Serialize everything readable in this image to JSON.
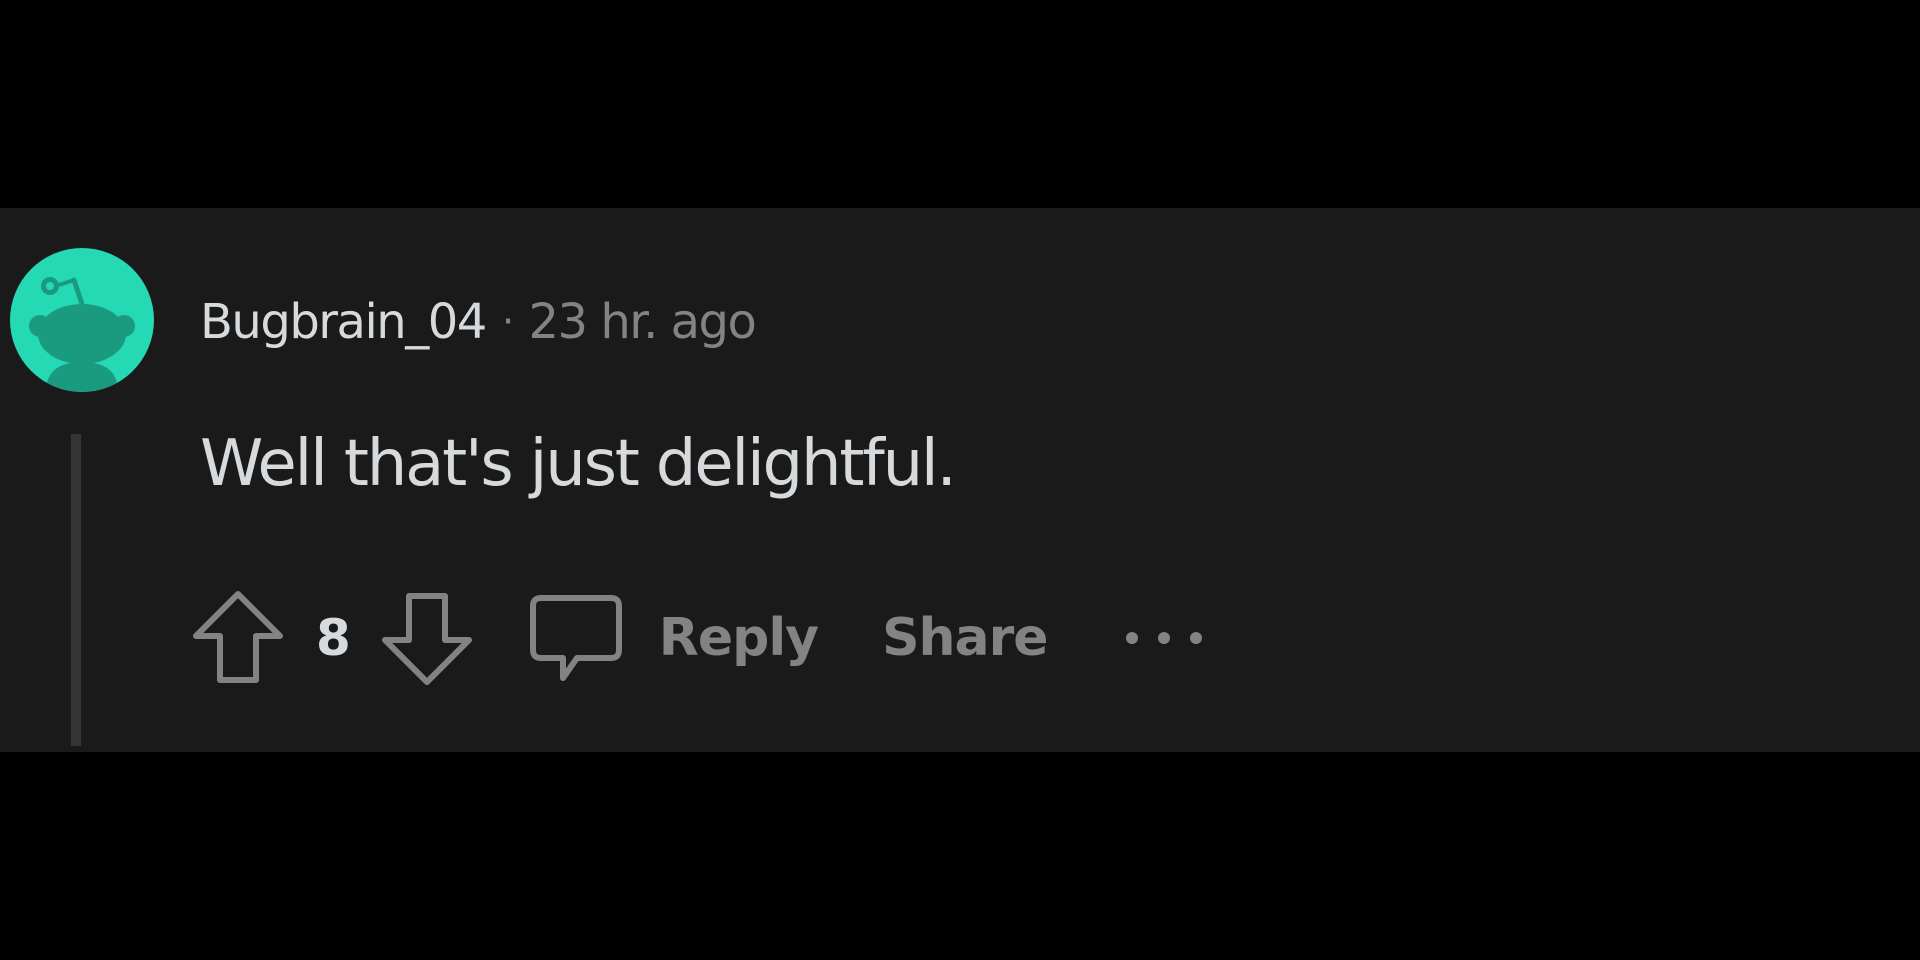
{
  "comment": {
    "username": "Bugbrain_04",
    "separator": "·",
    "timestamp": "23 hr. ago",
    "body": "Well that's just delightful.",
    "vote_count": "8",
    "avatar_icon": "snoo-avatar-icon",
    "avatar_color": "#24d9b4"
  },
  "actions": {
    "upvote_icon": "upvote-arrow-icon",
    "downvote_icon": "downvote-arrow-icon",
    "reply_icon": "speech-bubble-icon",
    "reply_label": "Reply",
    "share_label": "Share",
    "more_icon": "more-options-icon"
  },
  "colors": {
    "page_background": "#000000",
    "panel_background": "#1a1a1b",
    "primary_text": "#d7dadc",
    "secondary_text": "#818384",
    "thread_line": "#343536"
  }
}
